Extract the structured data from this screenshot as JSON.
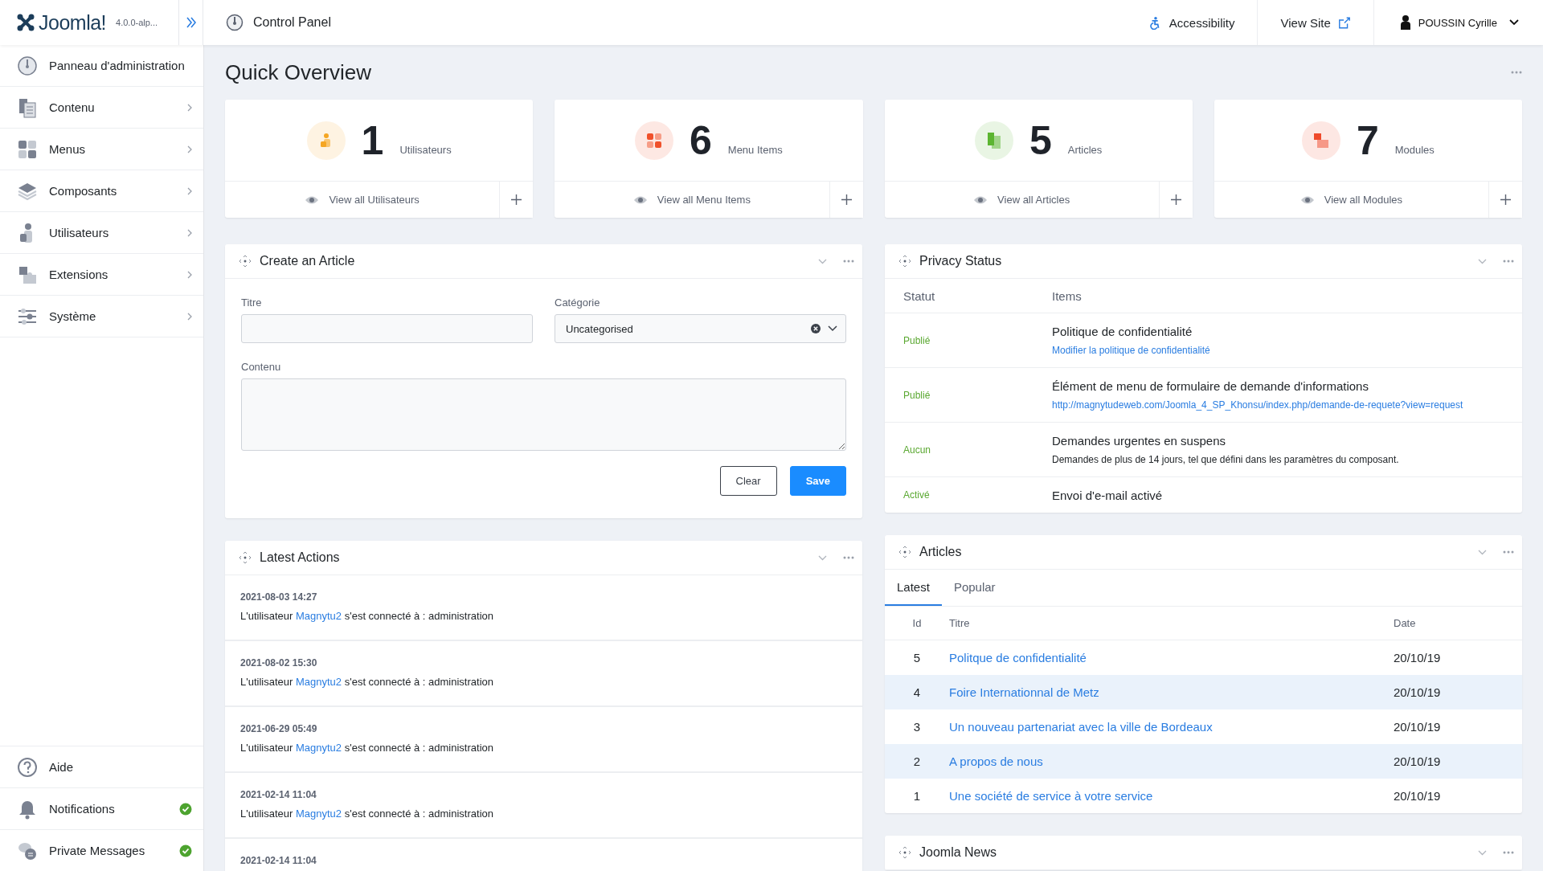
{
  "header": {
    "logo_text": "Joomla!",
    "version": "4.0.0-alp...",
    "page_title": "Control Panel",
    "links": [
      {
        "label": "Accessibility"
      },
      {
        "label": "View Site"
      }
    ],
    "user": "POUSSIN Cyrille"
  },
  "sidebar": {
    "items": [
      {
        "label": "Panneau d'administration",
        "expandable": false
      },
      {
        "label": "Contenu",
        "expandable": true
      },
      {
        "label": "Menus",
        "expandable": true
      },
      {
        "label": "Composants",
        "expandable": true
      },
      {
        "label": "Utilisateurs",
        "expandable": true
      },
      {
        "label": "Extensions",
        "expandable": true
      },
      {
        "label": "Système",
        "expandable": true
      }
    ],
    "bottom_items": [
      {
        "label": "Aide",
        "ok": false
      },
      {
        "label": "Notifications",
        "ok": true
      },
      {
        "label": "Private Messages",
        "ok": true
      }
    ]
  },
  "overview": {
    "title": "Quick Overview",
    "cards": [
      {
        "count": "1",
        "label": "Utilisateurs",
        "link": "View all Utilisateurs",
        "color": "#f5a623"
      },
      {
        "count": "6",
        "label": "Menu Items",
        "link": "View all Menu Items",
        "color": "#f0512b"
      },
      {
        "count": "5",
        "label": "Articles",
        "link": "View all Articles",
        "color": "#5cb531"
      },
      {
        "count": "7",
        "label": "Modules",
        "link": "View all Modules",
        "color": "#ef4a2b"
      }
    ]
  },
  "create_article": {
    "title": "Create an Article",
    "fields": [
      {
        "label": "Titre"
      },
      {
        "label": "Catégorie",
        "value": "Uncategorised"
      }
    ],
    "content_label": "Contenu",
    "buttons": [
      {
        "label": "Clear",
        "kind": "secondary"
      },
      {
        "label": "Save",
        "kind": "primary"
      }
    ]
  },
  "latest_actions": {
    "title": "Latest Actions",
    "items": [
      {
        "date": "2021-08-03 14:27",
        "before": "L'utilisateur",
        "user": "Magnytu2",
        "after": "s'est connecté à : administration"
      },
      {
        "date": "2021-08-02 15:30",
        "before": "L'utilisateur",
        "user": "Magnytu2",
        "after": "s'est connecté à : administration"
      },
      {
        "date": "2021-06-29 05:49",
        "before": "L'utilisateur",
        "user": "Magnytu2",
        "after": "s'est connecté à : administration"
      },
      {
        "date": "2021-02-14 11:04",
        "before": "L'utilisateur",
        "user": "Magnytu2",
        "after": "s'est connecté à : administration"
      },
      {
        "date": "2021-02-14 11:04"
      }
    ]
  },
  "privacy_status": {
    "title": "Privacy Status",
    "columns": [
      "Statut",
      "Items"
    ],
    "rows": [
      {
        "status": "Publié",
        "title": "Politique de confidentialité",
        "detail": "Modifier la politique de confidentialité",
        "kind": "link"
      },
      {
        "status": "Publié",
        "title": "Élément de menu de formulaire de demande d'informations",
        "detail": "http://magnytudeweb.com/Joomla_4_SP_Khonsu/index.php/demande-de-requete?view=request",
        "kind": "link"
      },
      {
        "status": "Aucun",
        "title": "Demandes urgentes en suspens",
        "detail": "Demandes de plus de 14 jours, tel que défini dans les paramètres du composant.",
        "kind": "text"
      },
      {
        "status": "Activé",
        "title": "Envoi d'e-mail activé"
      }
    ]
  },
  "articles": {
    "title": "Articles",
    "tabs": [
      {
        "label": "Latest",
        "selected": true
      },
      {
        "label": "Popular",
        "selected": false
      }
    ],
    "columns": [
      "Id",
      "Titre",
      "Date"
    ],
    "rows": [
      {
        "id": "5",
        "title": "Politque de confidentialité",
        "date": "20/10/19"
      },
      {
        "id": "4",
        "title": "Foire Internationnal de Metz",
        "date": "20/10/19"
      },
      {
        "id": "3",
        "title": "Un nouveau partenariat avec la ville de Bordeaux",
        "date": "20/10/19"
      },
      {
        "id": "2",
        "title": "A propos de nous",
        "date": "20/10/19"
      },
      {
        "id": "1",
        "title": "Une société de service à votre service",
        "date": "20/10/19"
      }
    ]
  },
  "joomla_news": {
    "title": "Joomla News"
  }
}
